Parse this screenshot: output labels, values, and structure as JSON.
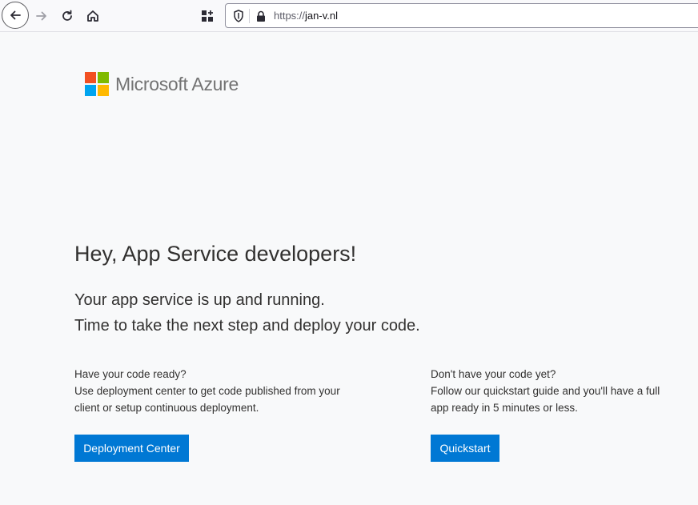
{
  "browser": {
    "url_scheme": "https://",
    "url_host": "jan-v.nl",
    "icons": [
      "back-icon",
      "forward-icon",
      "reload-icon",
      "home-icon",
      "extensions-icon",
      "shield-icon",
      "lock-icon"
    ]
  },
  "logo": {
    "text": "Microsoft Azure",
    "colors": [
      "#f25022",
      "#7fba00",
      "#00a4ef",
      "#ffb900"
    ]
  },
  "main": {
    "heading": "Hey, App Service developers!",
    "sub_line1": "Your app service is up and running.",
    "sub_line2": "Time to take the next step and deploy your code."
  },
  "left_col": {
    "line1": "Have your code ready?",
    "line2": "Use deployment center to get code published from your",
    "line3": "client or setup continuous deployment.",
    "button": "Deployment Center"
  },
  "right_col": {
    "line1": "Don't have your code yet?",
    "line2": "Follow our quickstart guide and you'll have a full",
    "line3": "app ready in 5 minutes or less.",
    "button": "Quickstart"
  },
  "theme": {
    "accent": "#0078d4",
    "background": "#f8f9fa"
  }
}
